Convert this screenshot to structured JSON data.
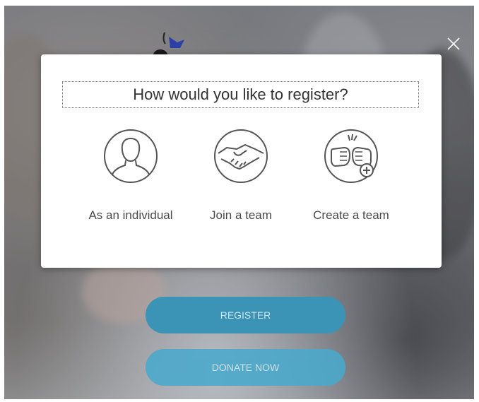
{
  "modal": {
    "title": "How would you like to register?",
    "close_icon": "close-icon",
    "options": [
      {
        "label": "As an individual",
        "icon": "person-icon"
      },
      {
        "label": "Join a team",
        "icon": "handshake-icon"
      },
      {
        "label": "Create a team",
        "icon": "fist-bump-plus-icon"
      }
    ]
  },
  "page": {
    "register_label": "REGISTER",
    "donate_label": "DONATE NOW"
  },
  "colors": {
    "register_button": "#3b93b6",
    "donate_button": "#4aa9cc",
    "icon_stroke": "#555555"
  }
}
